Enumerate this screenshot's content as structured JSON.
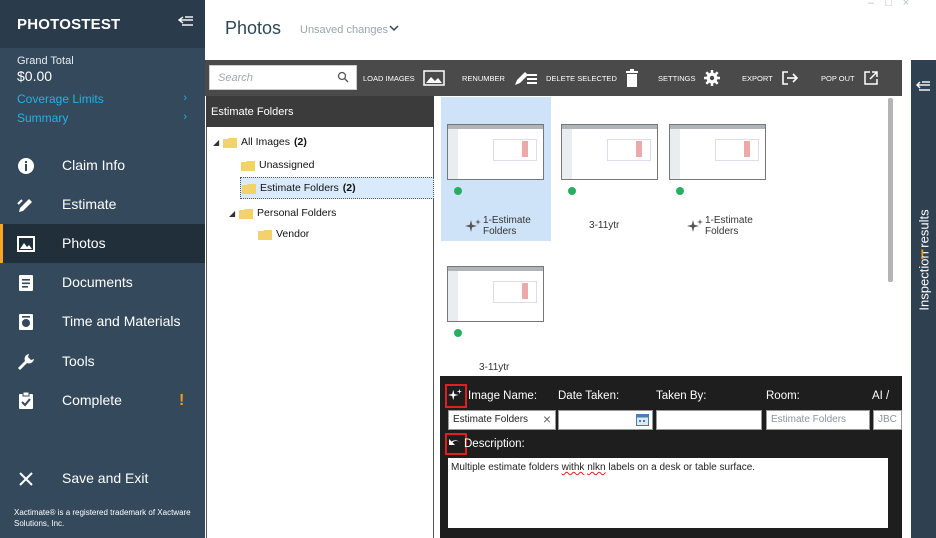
{
  "sidebar": {
    "brand": "PHOTOSTEST",
    "grand_total_label": "Grand Total",
    "grand_total_value": "$0.00",
    "links": [
      {
        "label": "Coverage Limits"
      },
      {
        "label": "Summary"
      }
    ],
    "nav": [
      {
        "label": "Claim Info",
        "icon": "info-icon"
      },
      {
        "label": "Estimate",
        "icon": "pencil-icon"
      },
      {
        "label": "Photos",
        "icon": "photo-icon",
        "active": true
      },
      {
        "label": "Documents",
        "icon": "documents-icon"
      },
      {
        "label": "Time and Materials",
        "icon": "time-materials-icon"
      },
      {
        "label": "Tools",
        "icon": "wrench-icon"
      },
      {
        "label": "Complete",
        "icon": "clipboard-check-icon",
        "warning": "!"
      }
    ],
    "save_exit": "Save and Exit",
    "trademark": "Xactimate® is a registered trademark of Xactware Solutions, Inc."
  },
  "header": {
    "title": "Photos",
    "status": "Unsaved changes"
  },
  "toolbar": {
    "search_placeholder": "Search",
    "load_images": "LOAD IMAGES",
    "reorder": "RENUMBER",
    "delete_selected": "DELETE SELECTED",
    "settings": "SETTINGS",
    "export": "EXPORT",
    "pop_out": "POP OUT"
  },
  "folders": {
    "header": "Estimate Folders",
    "tree": [
      {
        "label": "All Images",
        "count": "(2)"
      },
      {
        "label": "Unassigned",
        "count": ""
      },
      {
        "label": "Estimate Folders",
        "count": "(2)",
        "selected": true
      },
      {
        "label": "Personal Folders",
        "count": ""
      },
      {
        "label": "Vendor",
        "count": ""
      }
    ]
  },
  "gallery": {
    "items": [
      {
        "caption_line1": "1-Estimate",
        "caption_line2": "Folders",
        "ai": true,
        "selected": true
      },
      {
        "caption_line1": "3-11ytr",
        "caption_line2": "",
        "ai": false
      },
      {
        "caption_line1": "1-Estimate",
        "caption_line2": "Folders",
        "ai": true
      },
      {
        "caption_line1": "3-11ytr",
        "caption_line2": "",
        "ai": false
      }
    ]
  },
  "details": {
    "image_name_label": "Image Name:",
    "date_taken_label": "Date Taken:",
    "taken_by_label": "Taken By:",
    "room_label": "Room:",
    "ai_label": "AI /",
    "image_name_value": "Estimate Folders",
    "date_taken_value": "",
    "taken_by_value": "",
    "room_value": "Estimate Folders",
    "ai_value": "JBC",
    "description_label": "Description:",
    "description_value_1": "Multiple estimate folders ",
    "description_value_2": "withk",
    "description_value_3": " ",
    "description_value_4": "nlkn",
    "description_value_5": "  labels on a desk or table surface."
  },
  "rail": {
    "label": "Inspection results",
    "warning": "!"
  },
  "colors": {
    "sidebar": "#34495b",
    "accent_link": "#22b3e6",
    "active_bar": "#f6a623",
    "warning": "#f39c12",
    "status_dot": "#27ae60"
  }
}
